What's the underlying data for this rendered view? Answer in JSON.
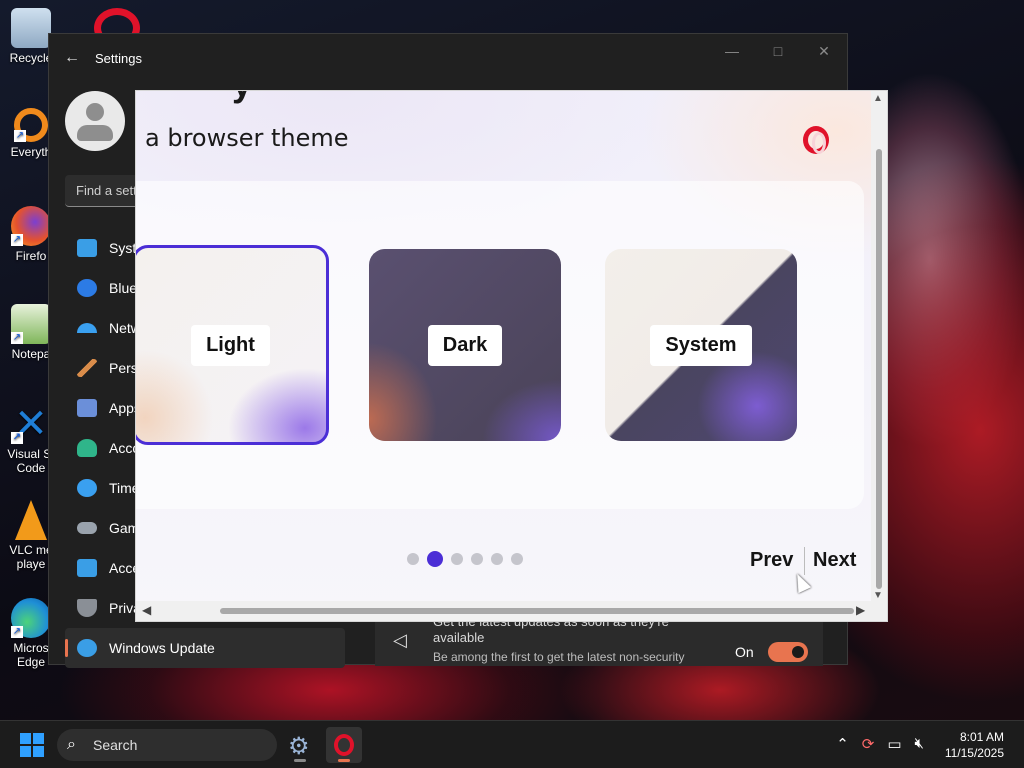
{
  "desktop": {
    "icons": [
      {
        "label": "Recycle",
        "color": "#9fb6cc"
      },
      {
        "label": "Everyth",
        "color": "#f08a1c"
      },
      {
        "label": "Firefo",
        "color": "#e5522d"
      },
      {
        "label": "Notepa",
        "color": "#7fb65a"
      },
      {
        "label": "Visual St Code",
        "color": "#1f7ed6"
      },
      {
        "label": "VLC me playe",
        "color": "#f29a1a"
      },
      {
        "label": "Micros Edge",
        "color": "#1f8fd6"
      }
    ]
  },
  "settings": {
    "title": "Settings",
    "back_icon": "←",
    "controls": {
      "minimize": "—",
      "maximize": "□",
      "close": "✕"
    },
    "search_placeholder": "Find a sett",
    "nav": [
      {
        "label": "Syste",
        "icon": "system-icon",
        "color": "#3a9ee6"
      },
      {
        "label": "Blue",
        "icon": "bluetooth-icon",
        "color": "#2c7be5"
      },
      {
        "label": "Netw",
        "icon": "wifi-icon",
        "color": "#3aa0f0"
      },
      {
        "label": "Perso",
        "icon": "brush-icon",
        "color": "#d98c4a"
      },
      {
        "label": "Apps",
        "icon": "apps-icon",
        "color": "#6b8fd9"
      },
      {
        "label": "Acco",
        "icon": "accounts-icon",
        "color": "#2fb58a"
      },
      {
        "label": "Time",
        "icon": "time-language-icon",
        "color": "#3aa0f0"
      },
      {
        "label": "Gam",
        "icon": "gaming-icon",
        "color": "#9aa3ad"
      },
      {
        "label": "Acce",
        "icon": "accessibility-icon",
        "color": "#3a9ee6"
      },
      {
        "label": "Priva",
        "icon": "privacy-shield-icon",
        "color": "#8a8f96"
      },
      {
        "label": "Windows Update",
        "icon": "windows-update-icon",
        "color": "#3a9ee6",
        "active": true
      }
    ],
    "update_banner": {
      "line1": "Get the latest updates as soon as they're available",
      "line2": "Be among the first to get the latest non-security",
      "toggle_state": "On",
      "toggle_on": true
    }
  },
  "opera_popup": {
    "heading_fragment": "y",
    "heading": "a browser theme",
    "themes": [
      {
        "label": "Light",
        "selected": true
      },
      {
        "label": "Dark",
        "selected": false
      },
      {
        "label": "System",
        "selected": false
      }
    ],
    "pagination": {
      "total": 6,
      "current": 2
    },
    "prev_label": "Prev",
    "next_label": "Next",
    "accent": "#4b2ed6",
    "brand": "#e0122a"
  },
  "taskbar": {
    "search_label": "Search",
    "time": "8:01 AM",
    "date": "11/15/2025"
  }
}
